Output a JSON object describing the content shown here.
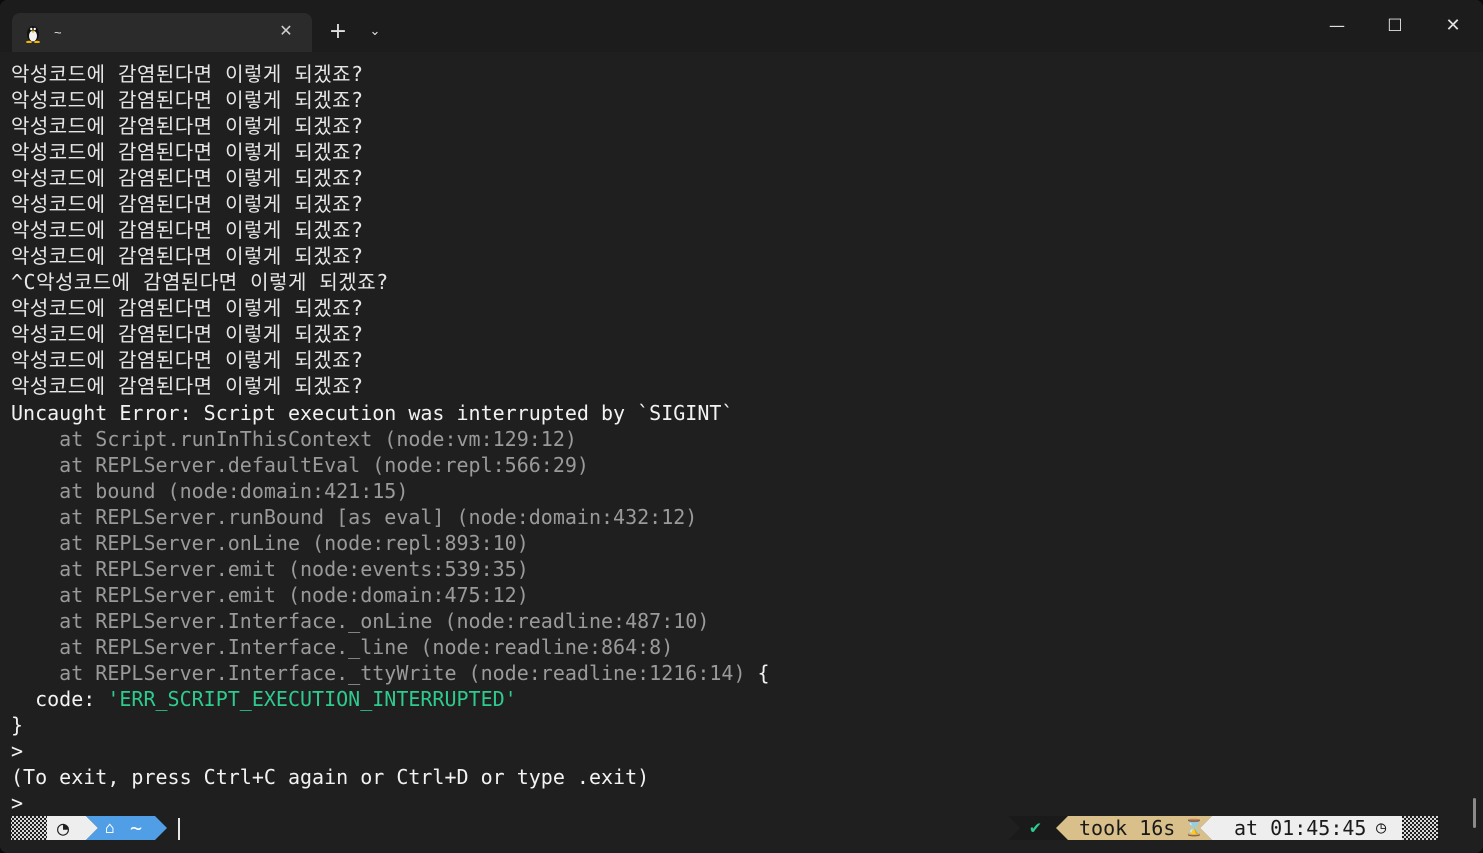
{
  "tab": {
    "title": "~",
    "icon": "linux-penguin-icon"
  },
  "titlebar": {
    "new_tab": "+",
    "dropdown": "⌄",
    "minimize": "—",
    "maximize": "☐",
    "close": "✕"
  },
  "terminal": {
    "output_lines": [
      "악성코드에 감염된다면 이렇게 되겠죠?",
      "악성코드에 감염된다면 이렇게 되겠죠?",
      "악성코드에 감염된다면 이렇게 되겠죠?",
      "악성코드에 감염된다면 이렇게 되겠죠?",
      "악성코드에 감염된다면 이렇게 되겠죠?",
      "악성코드에 감염된다면 이렇게 되겠죠?",
      "악성코드에 감염된다면 이렇게 되겠죠?",
      "악성코드에 감염된다면 이렇게 되겠죠?",
      "^C악성코드에 감염된다면 이렇게 되겠죠?",
      "악성코드에 감염된다면 이렇게 되겠죠?",
      "악성코드에 감염된다면 이렇게 되겠죠?",
      "악성코드에 감염된다면 이렇게 되겠죠?",
      "악성코드에 감염된다면 이렇게 되겠죠?"
    ],
    "error_header": "Uncaught Error: Script execution was interrupted by `SIGINT`",
    "stack": [
      "    at Script.runInThisContext (node:vm:129:12)",
      "    at REPLServer.defaultEval (node:repl:566:29)",
      "    at bound (node:domain:421:15)",
      "    at REPLServer.runBound [as eval] (node:domain:432:12)",
      "    at REPLServer.onLine (node:repl:893:10)",
      "    at REPLServer.emit (node:events:539:35)",
      "    at REPLServer.emit (node:domain:475:12)",
      "    at REPLServer.Interface._onLine (node:readline:487:10)",
      "    at REPLServer.Interface._line (node:readline:864:8)",
      "    at REPLServer.Interface._ttyWrite (node:readline:1216:14)"
    ],
    "stack_open_brace": " {",
    "code_key": "  code: ",
    "code_value": "'ERR_SCRIPT_EXECUTION_INTERRUPTED'",
    "close_brace": "}",
    "prompt1": ">",
    "exit_hint": "(To exit, press Ctrl+C again or Ctrl+D or type .exit)",
    "prompt2": ">"
  },
  "prompt": {
    "os_icon": "linux-icon",
    "home_icon": "home-icon",
    "dir": "~",
    "status_check": "✔",
    "took": "took 16s",
    "hourglass": "⌛",
    "time": "at 01:45:45",
    "clock": "◷",
    "colors": {
      "os_seg": "#eeeeee",
      "dir_seg": "#4f9ee6",
      "status_seg": "#1a1a1a",
      "took_seg": "#d9c08a",
      "time_seg": "#eeeeee",
      "check": "#2ecb8f"
    }
  }
}
